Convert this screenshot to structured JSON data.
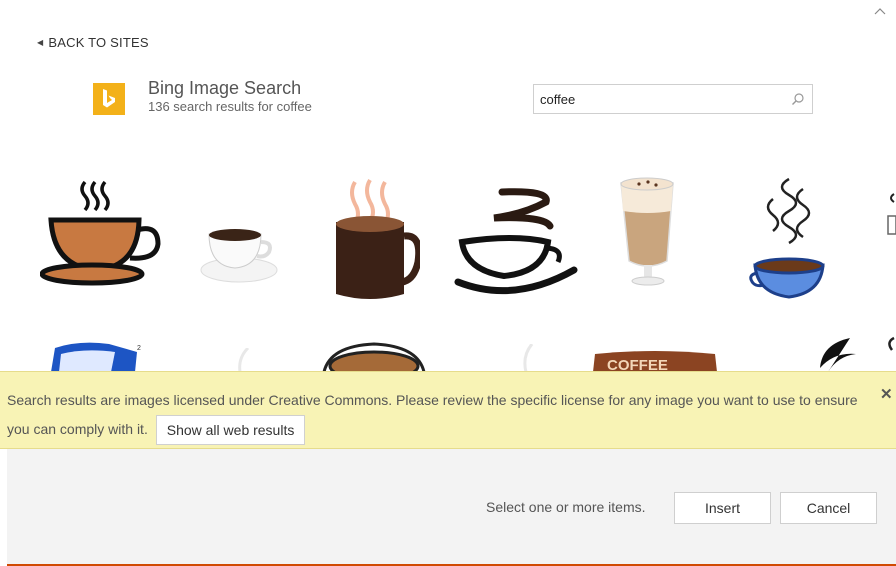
{
  "nav": {
    "back_label": "BACK TO SITES"
  },
  "provider": {
    "title": "Bing Image Search",
    "subtitle": "136 search results for coffee"
  },
  "search": {
    "value": "coffee",
    "placeholder": ""
  },
  "icons": {
    "collapse": "chevron-up-icon",
    "back": "triangle-left-icon",
    "logo": "bing-logo-icon",
    "search": "magnifier-icon",
    "close": "close-icon"
  },
  "results": [
    "coffee-cup-orange-icon",
    "espresso-cup-icon",
    "dark-mug-icon",
    "stylized-swirl-cup-icon",
    "latte-glass-icon",
    "blue-cup-steam-icon",
    "coffee-can-icon",
    "coffee-cup-brown-icon",
    "coffee-sign-icon",
    "black-bean-swirl-icon"
  ],
  "notice": {
    "text": "Search results are images licensed under Creative Commons. Please review the specific license for any image you want to use to ensure you can comply with it.",
    "button_label": "Show all web results"
  },
  "footer": {
    "hint": "Select one or more items.",
    "insert_label": "Insert",
    "cancel_label": "Cancel"
  },
  "colors": {
    "bing_yellow": "#f3b119",
    "notice_bg": "#f8f3b5",
    "footer_bg": "#f3f3f3",
    "accent": "#d04a02"
  }
}
